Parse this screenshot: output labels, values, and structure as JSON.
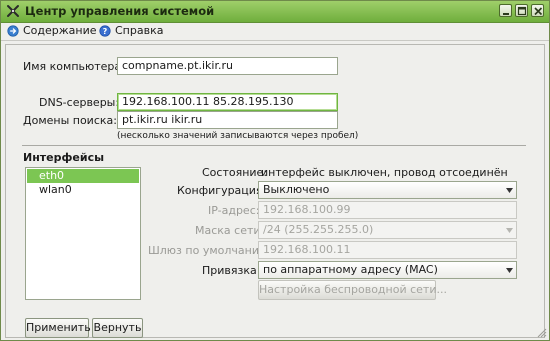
{
  "window": {
    "title": "Центр управления системой"
  },
  "menu": {
    "contents": "Содержание",
    "help": "Справка"
  },
  "form": {
    "hostname_label": "Имя компьютера:",
    "hostname_value": "compname.pt.ikir.ru",
    "dns_label": "DNS-серверы:",
    "dns_value": "192.168.100.11 85.28.195.130",
    "search_label": "Домены поиска:",
    "search_value": "pt.ikir.ru ikir.ru",
    "search_note": "(несколько значений записываются через пробел)"
  },
  "interfaces": {
    "title": "Интерфейсы",
    "items": [
      "eth0",
      "wlan0"
    ],
    "selected": "eth0"
  },
  "details": {
    "state_label": "Состояние:",
    "state_value": "интерфейс выключен, провод отсоединён",
    "config_label": "Конфигурация:",
    "config_value": "Выключено",
    "ip_label": "IP-адрес:",
    "ip_value": "192.168.100.99",
    "mask_label": "Маска сети:",
    "mask_value": "/24 (255.255.255.0)",
    "gw_label": "Шлюз по умолчанию:",
    "gw_value": "192.168.100.11",
    "bind_label": "Привязка:",
    "bind_value": "по  аппаратному адресу (MAC)",
    "wireless_button": "Настройка беспроводной сети..."
  },
  "buttons": {
    "apply": "Применить",
    "revert": "Вернуть"
  },
  "icons": {
    "app": "tools-icon",
    "contents": "contents-icon",
    "help": "help-icon",
    "minimize": "minimize-icon",
    "maximize": "maximize-icon",
    "close": "close-icon"
  },
  "colors": {
    "titlebar": "#7dbb48",
    "selection": "#7cc653",
    "focus_border": "#6fb541"
  }
}
